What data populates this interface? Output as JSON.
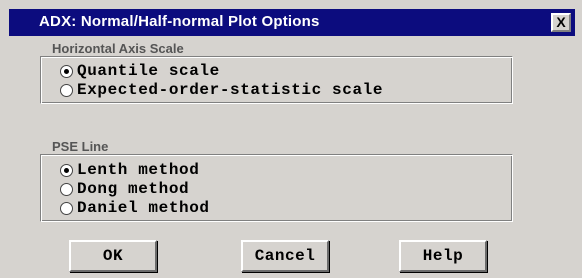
{
  "window": {
    "title": "ADX: Normal/Half-normal Plot Options",
    "close_label": "X"
  },
  "horizontal_axis_scale": {
    "label": "Horizontal Axis Scale",
    "options": [
      {
        "label": "Quantile scale",
        "selected": true
      },
      {
        "label": "Expected-order-statistic scale",
        "selected": false
      }
    ]
  },
  "pse_line": {
    "label": "PSE Line",
    "options": [
      {
        "label": "Lenth method",
        "selected": true
      },
      {
        "label": "Dong method",
        "selected": false
      },
      {
        "label": "Daniel method",
        "selected": false
      }
    ]
  },
  "buttons": {
    "ok": "OK",
    "cancel": "Cancel",
    "help": "Help"
  },
  "colors": {
    "title_bar": "#0c0c7e",
    "dialog_bg": "#d6d3cf"
  }
}
